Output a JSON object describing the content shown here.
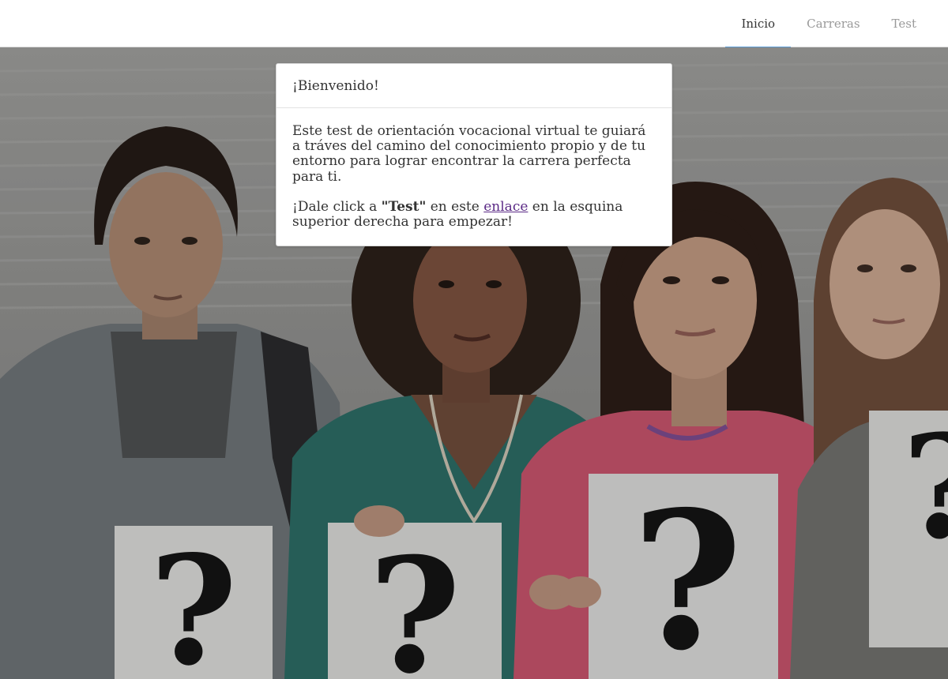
{
  "nav": {
    "items": [
      {
        "label": "Inicio",
        "active": true
      },
      {
        "label": "Carreras",
        "active": false
      },
      {
        "label": "Test",
        "active": false
      }
    ]
  },
  "card": {
    "title": "¡Bienvenido!",
    "paragraph1": "Este test de orientación vocacional virtual te guiará a tráves del camino del conocimiento propio y de tu entorno para lograr encontrar la carrera perfecta para ti.",
    "p2_prefix": "¡Dale click a ",
    "p2_bold": "\"Test\"",
    "p2_middle": " en este ",
    "p2_link": "enlace",
    "p2_suffix": " en la esquina superior derecha para empezar!"
  },
  "hero": {
    "image_description_icon": "question-mark-sign",
    "sign_glyph": "?"
  },
  "colors": {
    "accent": "#5b9bd5",
    "link": "#5b2a86",
    "nav_inactive": "#9a9a9a",
    "nav_active": "#333333"
  }
}
